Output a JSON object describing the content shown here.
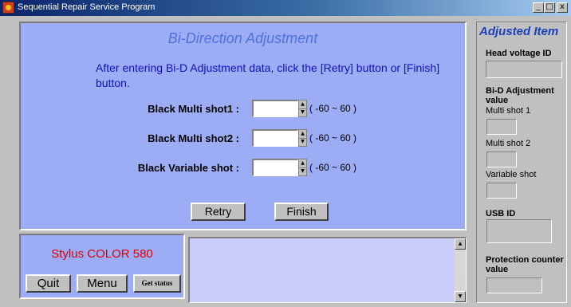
{
  "window": {
    "title": "Sequential Repair Service Program",
    "minimize_glyph": "_",
    "maximize_glyph": "□",
    "close_glyph": "x"
  },
  "main": {
    "heading": "Bi-Direction Adjustment",
    "instruction": "After entering Bi-D Adjustment data, click the [Retry] button or [Finish] button.",
    "fields": [
      {
        "label": "Black Multi shot1 :",
        "value": "",
        "range": "( -60 ~ 60 )"
      },
      {
        "label": "Black Multi shot2 :",
        "value": "",
        "range": "( -60 ~ 60 )"
      },
      {
        "label": "Black Variable shot :",
        "value": "",
        "range": "( -60 ~ 60 )"
      }
    ],
    "retry_label": "Retry",
    "finish_label": "Finish"
  },
  "bottom": {
    "model": "Stylus COLOR 580",
    "quit_label": "Quit",
    "menu_label": "Menu",
    "get_status_label": "Get status",
    "log_text": ""
  },
  "sidebar": {
    "title": "Adjusted Item",
    "head_voltage_label": "Head voltage ID",
    "bid_label": "Bi-D Adjustment value",
    "multi1_label": "Multi shot 1",
    "multi2_label": "Multi shot 2",
    "variable_label": "Variable shot",
    "usb_label": "USB ID",
    "protection_label": "Protection counter value"
  },
  "colors": {
    "panel": "#9cadf5",
    "heading": "#5070e0",
    "instruction": "#1010c0",
    "model": "#e00000",
    "sidebar_title": "#1c3fc0"
  }
}
